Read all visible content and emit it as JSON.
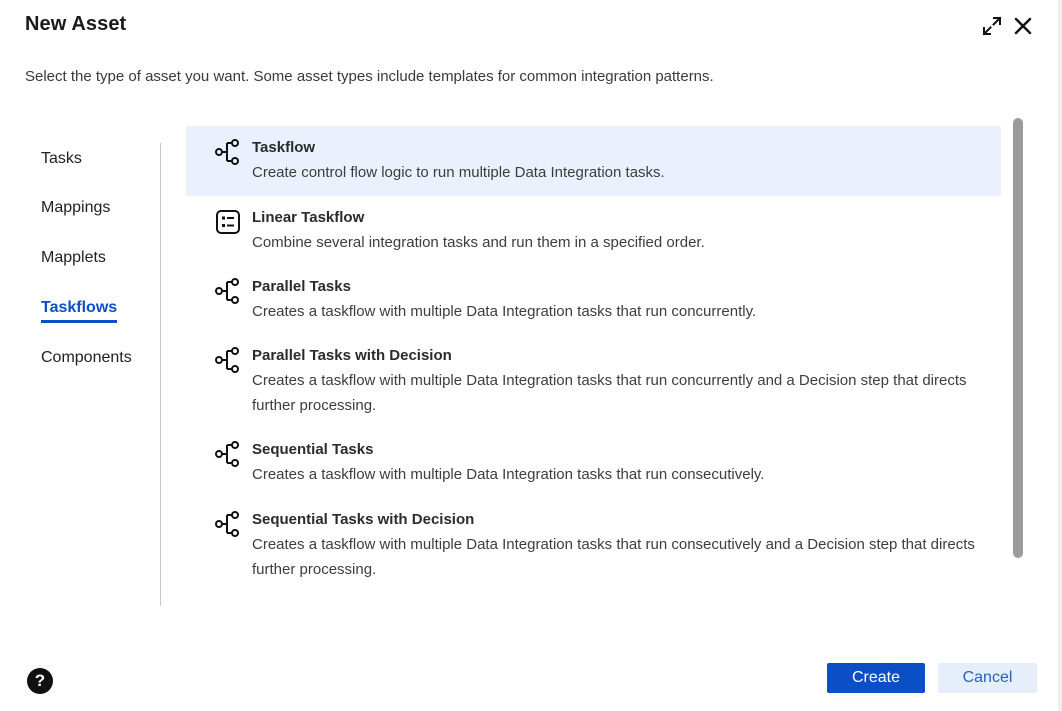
{
  "dialog": {
    "title": "New Asset",
    "subtitle": "Select the type of asset you want. Some asset types include templates for common integration patterns."
  },
  "nav": {
    "items": [
      {
        "label": "Tasks"
      },
      {
        "label": "Mappings"
      },
      {
        "label": "Mapplets"
      },
      {
        "label": "Taskflows",
        "active": true
      },
      {
        "label": "Components"
      }
    ]
  },
  "assets": [
    {
      "name": "Taskflow",
      "description": "Create control flow logic to run multiple Data Integration tasks.",
      "icon": "taskflow-icon",
      "selected": true
    },
    {
      "name": "Linear Taskflow",
      "description": "Combine several integration tasks and run them in a specified order.",
      "icon": "checklist-icon"
    },
    {
      "name": "Parallel Tasks",
      "description": "Creates a taskflow with multiple Data Integration tasks that run concurrently.",
      "icon": "taskflow-icon"
    },
    {
      "name": "Parallel Tasks with Decision",
      "description": "Creates a taskflow with multiple Data Integration tasks that run concurrently and a Decision step that directs further processing.",
      "icon": "taskflow-icon"
    },
    {
      "name": "Sequential Tasks",
      "description": "Creates a taskflow with multiple Data Integration tasks that run consecutively.",
      "icon": "taskflow-icon"
    },
    {
      "name": "Sequential Tasks with Decision",
      "description": "Creates a taskflow with multiple Data Integration tasks that run consecutively and a Decision step that directs further processing.",
      "icon": "taskflow-icon"
    }
  ],
  "footer": {
    "help_label": "?",
    "create_label": "Create",
    "cancel_label": "Cancel"
  },
  "colors": {
    "accent": "#0b4fc7",
    "selected_row": "#eaf1fd",
    "cancel_bg": "#e6eefa"
  }
}
